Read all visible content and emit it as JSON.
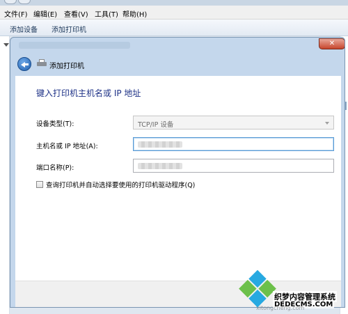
{
  "menubar": {
    "items": [
      "文件(F)",
      "编辑(E)",
      "查看(V)",
      "工具(T)",
      "帮助(H)"
    ]
  },
  "command_bar": {
    "add_device": "添加设备",
    "add_printer": "添加打印机"
  },
  "dialog": {
    "title": "添加打印机",
    "heading": "键入打印机主机名或 IP 地址",
    "device_type_label": "设备类型(T):",
    "device_type_value": "TCP/IP 设备",
    "hostname_label": "主机名或 IP 地址(A):",
    "hostname_value": "",
    "port_name_label": "端口名称(P):",
    "port_name_value": "",
    "query_checkbox_label": "查询打印机并自动选择要使用的打印机驱动程序(Q)",
    "query_checkbox_checked": false,
    "close_glyph": "✕"
  },
  "watermark": {
    "cn": "织梦内容管理系统",
    "en": "DEDECMS.COM",
    "url": "xitongcheng.com"
  },
  "colors": {
    "heading": "#1e3287",
    "focus_border": "#5a9bd5",
    "close_button": "#c7452c"
  }
}
